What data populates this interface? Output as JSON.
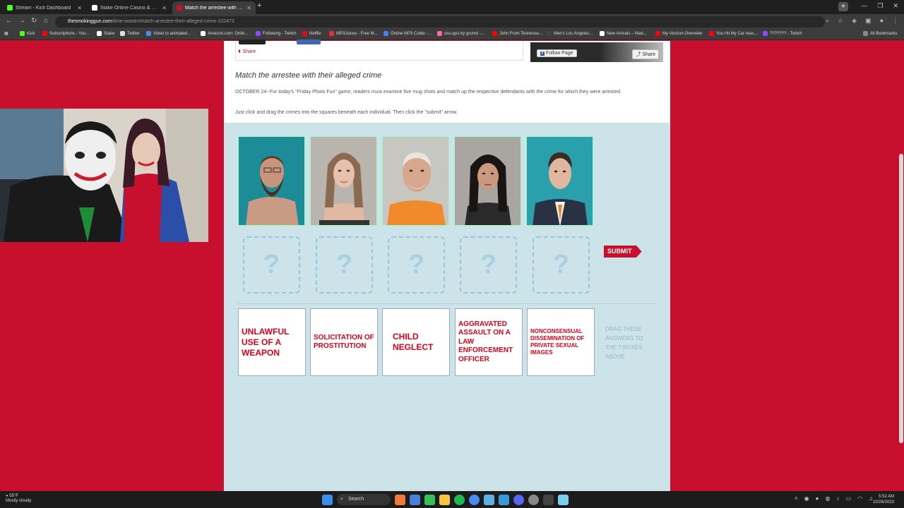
{
  "browser": {
    "tabs": [
      {
        "title": "Stream - Kick Dashboard",
        "color": "#53fc18"
      },
      {
        "title": "Stake Online Casino & Sports",
        "color": "#ffffff"
      },
      {
        "title": "Match the arrestee with their a",
        "color": "#c8102e"
      }
    ],
    "url_host": "thesmokinggun.com",
    "url_path": "/time-waster/match-arrestee-their-alleged-crime-102473",
    "bookmarks": [
      {
        "label": "Kick",
        "color": "#53fc18"
      },
      {
        "label": "Subscriptions - You...",
        "color": "#ff0000"
      },
      {
        "label": "Stake",
        "color": "#ffffff"
      },
      {
        "label": "Twitter",
        "color": "#dddddd"
      },
      {
        "label": "Video to animated...",
        "color": "#4a90d9"
      },
      {
        "label": "Amazon.com: Onlin...",
        "color": "#ffffff"
      },
      {
        "label": "Following - Twitch",
        "color": "#9146ff"
      },
      {
        "label": "Netflix",
        "color": "#e50914"
      },
      {
        "label": "MP3Juices - Free M...",
        "color": "#e03030"
      },
      {
        "label": "Online MP3 Cutter -...",
        "color": "#3b82f6"
      },
      {
        "label": "osu-pps by grumd -...",
        "color": "#ff66aa"
      },
      {
        "label": "John From Tennesse...",
        "color": "#ff0000"
      },
      {
        "label": "Men's Los Angeles...",
        "color": "#444444"
      },
      {
        "label": "New Arrivals – Mad...",
        "color": "#ffffff"
      },
      {
        "label": "My Verizon Overview",
        "color": "#ff0000"
      },
      {
        "label": "You Hit My Car reac...",
        "color": "#ff0000"
      },
      {
        "label": "??????? - Twitch",
        "color": "#9146ff"
      }
    ],
    "all_bookmarks": "All Bookmarks"
  },
  "page": {
    "share": "Share",
    "follow_page": "Follow Page",
    "fb_share": "Share",
    "title": "Match the arrestee with their alleged crime",
    "intro": "OCTOBER 24--For today's \"Friday Photo Fun\" game, readers must examine five mug shots and match up the respective defendants with the crime for which they were arrested.",
    "instructions": "Just click and drag the crimes into the squares beneath each individual. Then click the \"submit\" arrow.",
    "slot_symbol": "?",
    "submit": "SUBMIT",
    "answers": [
      "UNLAWFUL USE OF A WEAPON",
      "SOLICITATION OF PROSTITUTION",
      "CHILD NEGLECT",
      "AGGRAVATED ASSAULT ON A LAW ENFORCEMENT OFFICER",
      "NONCONSENSUAL DISSEMINATION OF PRIVATE SEXUAL IMAGES"
    ],
    "drag_hint": "DRAG THESE ANSWERS TO THE ? BOXES ABOVE"
  },
  "taskbar": {
    "temp": "55°F",
    "weather": "Mostly cloudy",
    "search": "Search",
    "time": "5:52 AM",
    "date": "10/26/2023"
  }
}
